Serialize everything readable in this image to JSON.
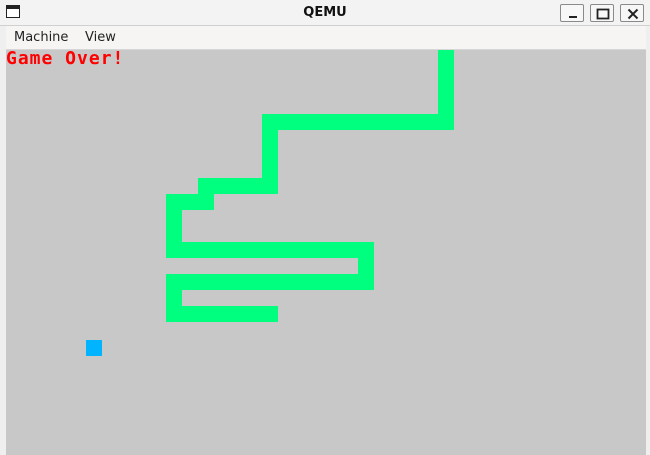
{
  "window": {
    "title": "QEMU"
  },
  "menu": {
    "items": [
      "Machine",
      "View"
    ]
  },
  "game": {
    "status_text": "Game Over!",
    "snake_color": "#00ff7f",
    "food_color": "#00b4ff",
    "text_color": "#ff0000",
    "screen_bg": "#c8c8c8"
  },
  "icons": {
    "window_controls": [
      "minimize-icon",
      "maximize-icon",
      "close-icon"
    ],
    "app": "window-app-icon"
  }
}
